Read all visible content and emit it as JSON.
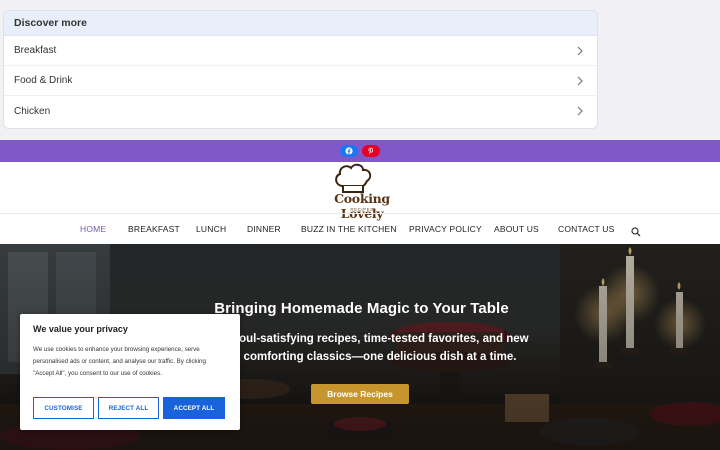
{
  "discover": {
    "title": "Discover more",
    "items": [
      {
        "label": "Breakfast"
      },
      {
        "label": "Food & Drink"
      },
      {
        "label": "Chicken"
      }
    ]
  },
  "social": {
    "icons": [
      "facebook-icon",
      "pinterest-icon"
    ],
    "bar_color": "#8158c8"
  },
  "logo": {
    "text": "Cooking Lovely",
    "subtitle": "RECIPES"
  },
  "nav": {
    "items": [
      {
        "label": "HOME",
        "active": true
      },
      {
        "label": "BREAKFAST"
      },
      {
        "label": "LUNCH"
      },
      {
        "label": "DINNER"
      },
      {
        "label": "BUZZ IN THE KITCHEN"
      },
      {
        "label": "PRIVACY POLICY"
      },
      {
        "label": "ABOUT US"
      },
      {
        "label": "CONTACT US"
      }
    ],
    "active_color": "#7a58b8"
  },
  "hero": {
    "title": "Bringing Homemade Magic to Your Table",
    "subtitle": "Soul-satisfying recipes, time-tested favorites, and new comforting classics—one delicious dish at a time.",
    "button": "Browse Recipes",
    "button_color": "#c7952e"
  },
  "cookie": {
    "title": "We value your privacy",
    "body": "We use cookies to enhance your browsing experience, serve personalised ads or content, and analyse our traffic. By clicking \"Accept All\", you consent to our use of cookies.",
    "customise": "CUSTOMISE",
    "reject": "REJECT ALL",
    "accept": "ACCEPT ALL",
    "accent_color": "#1863dc"
  }
}
